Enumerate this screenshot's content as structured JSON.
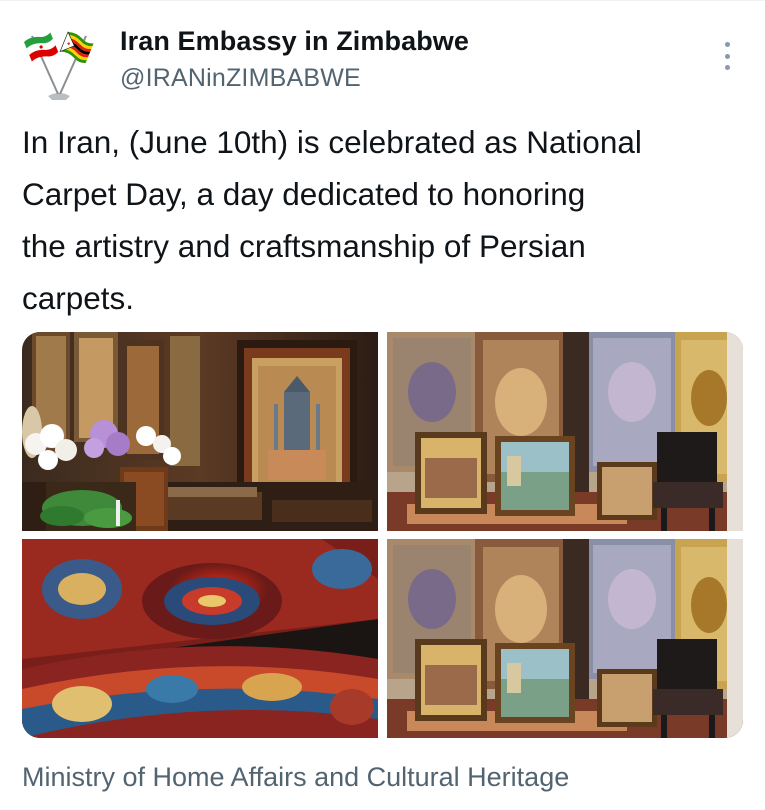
{
  "account": {
    "display_name": "Iran Embassy in Zimbabwe",
    "handle": "@IRANinZIMBABWE",
    "avatar_icon": "crossed-flags-iran-zimbabwe-icon"
  },
  "tweet": {
    "text": "In Iran, (June 10th) is celebrated as National\nCarpet Day, a day dedicated to honoring\nthe artistry and craftsmanship of Persian\ncarpets."
  },
  "media": {
    "count": 4,
    "items": [
      {
        "depicts": "carpet-exhibition-with-orchids-photo"
      },
      {
        "depicts": "carpet-shop-with-paintings-photo"
      },
      {
        "depicts": "rolled-persian-carpet-closeup-photo"
      },
      {
        "depicts": "carpet-shop-with-paintings-photo"
      }
    ]
  },
  "footer": {
    "text": "Ministry of Home Affairs and Cultural Heritage"
  },
  "colors": {
    "text_primary": "#0f1419",
    "text_secondary": "#536471",
    "iran_green": "#239f40",
    "iran_red": "#da0000",
    "zimbabwe_yellow": "#ffd200"
  }
}
